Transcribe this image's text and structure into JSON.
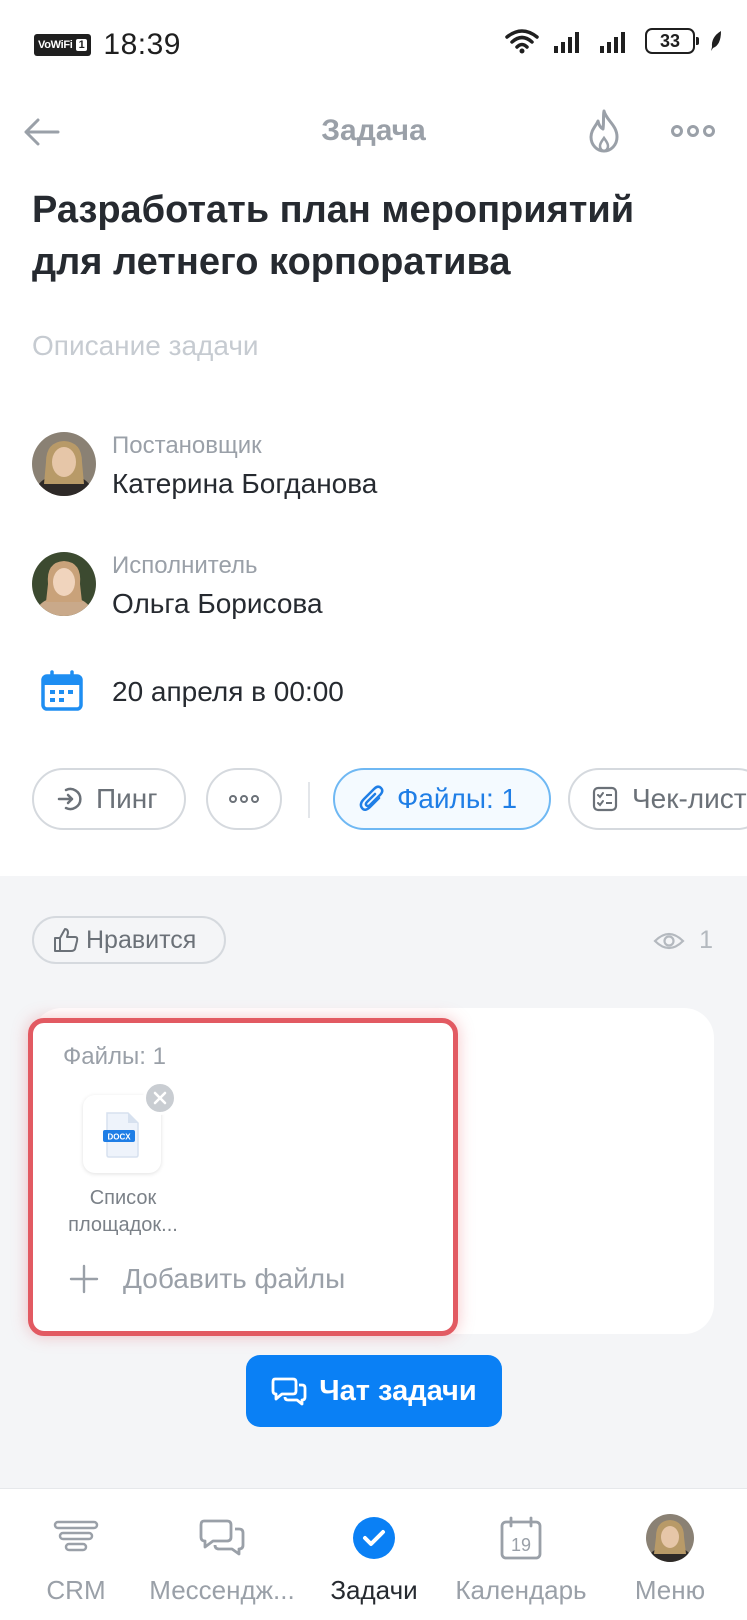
{
  "status_bar": {
    "network_badge": "VoWiFi",
    "network_badge_num": "1",
    "time": "18:39",
    "battery": "33"
  },
  "header": {
    "title": "Задача"
  },
  "task": {
    "title": "Разработать план мероприятий для летнего корпоратива",
    "description_placeholder": "Описание задачи",
    "creator_role": "Постановщик",
    "creator_name": "Катерина Богданова",
    "responsible_role": "Исполнитель",
    "responsible_name": "Ольга Борисова",
    "deadline": "20 апреля в 00:00"
  },
  "chips": {
    "ping": "Пинг",
    "files": "Файлы: 1",
    "checklist": "Чек-лист"
  },
  "feedback": {
    "like_label": "Нравится",
    "views_count": "1"
  },
  "files_panel": {
    "label": "Файлы: 1",
    "file_type": "DOCX",
    "file_name_line1": "Список",
    "file_name_line2": "площадок...",
    "add_label": "Добавить файлы"
  },
  "chat_button": "Чат задачи",
  "bottom_nav": {
    "crm": "CRM",
    "messenger": "Мессендж...",
    "tasks": "Задачи",
    "calendar": "Календарь",
    "calendar_day": "19",
    "menu": "Меню"
  },
  "colors": {
    "accent": "#0a80f5",
    "highlight": "#e25a62",
    "chip_active": "#1f7ee6"
  }
}
